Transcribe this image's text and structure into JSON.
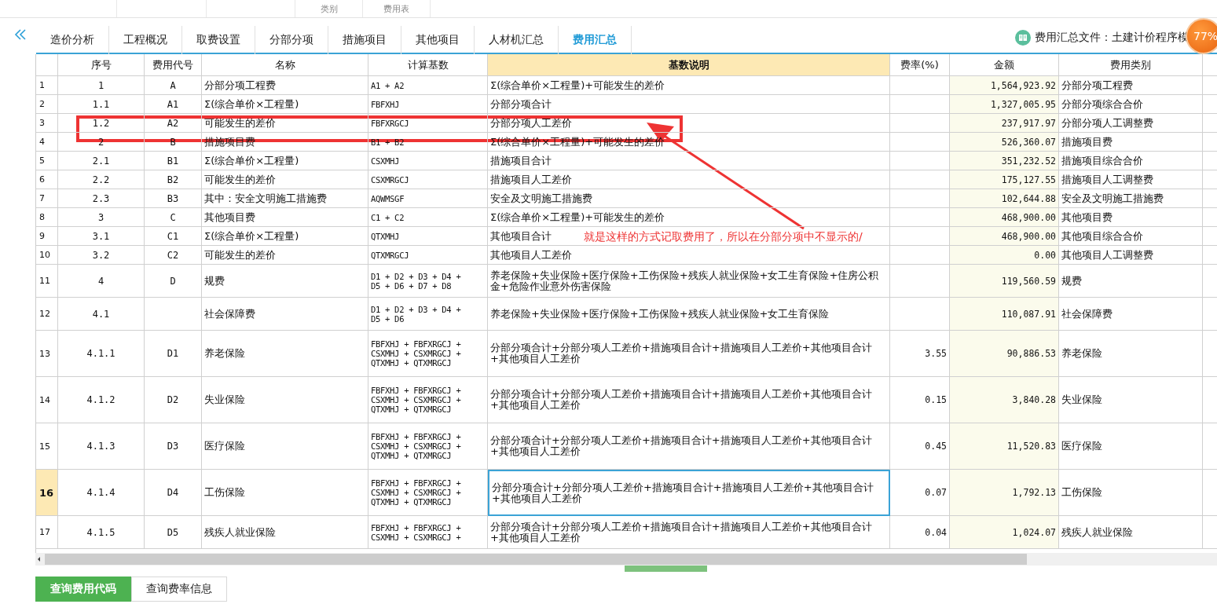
{
  "top_strip": [
    "类别",
    "费用表"
  ],
  "tabs": [
    {
      "label": "造价分析",
      "selected": false
    },
    {
      "label": "工程概况",
      "selected": false
    },
    {
      "label": "取费设置",
      "selected": false
    },
    {
      "label": "分部分项",
      "selected": false
    },
    {
      "label": "措施项目",
      "selected": false
    },
    {
      "label": "其他项目",
      "selected": false
    },
    {
      "label": "人材机汇总",
      "selected": false
    },
    {
      "label": "费用汇总",
      "selected": true
    }
  ],
  "file_label": "费用汇总文件：土建计价程序模",
  "progress_badge": "77%",
  "table": {
    "columns": [
      "序号",
      "费用代号",
      "名称",
      "计算基数",
      "基数说明",
      "费率(%)",
      "金额",
      "费用类别"
    ],
    "rows": [
      {
        "index": "1",
        "no": "1",
        "code": "A",
        "name": "分部分项工程费",
        "calc": [
          "A1 + A2"
        ],
        "desc": "Σ(综合单价×工程量)+可能发生的差价",
        "rate": "",
        "amount": "1,564,923.92",
        "category": "分部分项工程费",
        "selected": false
      },
      {
        "index": "2",
        "no": "1.1",
        "code": "A1",
        "name": "Σ(综合单价×工程量)",
        "calc": [
          "FBFXHJ"
        ],
        "desc": "分部分项合计",
        "rate": "",
        "amount": "1,327,005.95",
        "category": "分部分项综合合价",
        "selected": false
      },
      {
        "index": "3",
        "no": "1.2",
        "code": "A2",
        "name": "可能发生的差价",
        "calc": [
          "FBFXRGCJ"
        ],
        "desc": "分部分项人工差价",
        "rate": "",
        "amount": "237,917.97",
        "category": "分部分项人工调整费",
        "selected": false
      },
      {
        "index": "4",
        "no": "2",
        "code": "B",
        "name": "措施项目费",
        "calc": [
          "B1 + B2"
        ],
        "desc": "Σ(综合单价×工程量)+可能发生的差价",
        "rate": "",
        "amount": "526,360.07",
        "category": "措施项目费",
        "selected": false
      },
      {
        "index": "5",
        "no": "2.1",
        "code": "B1",
        "name": "Σ(综合单价×工程量)",
        "calc": [
          "CSXMHJ"
        ],
        "desc": "措施项目合计",
        "rate": "",
        "amount": "351,232.52",
        "category": "措施项目综合合价",
        "selected": false
      },
      {
        "index": "6",
        "no": "2.2",
        "code": "B2",
        "name": "可能发生的差价",
        "calc": [
          "CSXMRGCJ"
        ],
        "desc": "措施项目人工差价",
        "rate": "",
        "amount": "175,127.55",
        "category": "措施项目人工调整费",
        "selected": false
      },
      {
        "index": "7",
        "no": "2.3",
        "code": "B3",
        "name": "其中：安全文明施工措施费",
        "calc": [
          "AQWMSGF"
        ],
        "desc": "安全及文明施工措施费",
        "rate": "",
        "amount": "102,644.88",
        "category": "安全及文明施工措施费",
        "selected": false
      },
      {
        "index": "8",
        "no": "3",
        "code": "C",
        "name": "其他项目费",
        "calc": [
          "C1 + C2"
        ],
        "desc": "Σ(综合单价×工程量)+可能发生的差价",
        "rate": "",
        "amount": "468,900.00",
        "category": "其他项目费",
        "selected": false
      },
      {
        "index": "9",
        "no": "3.1",
        "code": "C1",
        "name": "Σ(综合单价×工程量)",
        "calc": [
          "QTXMHJ"
        ],
        "desc": "其他项目合计",
        "rate": "",
        "amount": "468,900.00",
        "category": "其他项目综合合价",
        "selected": false
      },
      {
        "index": "10",
        "no": "3.2",
        "code": "C2",
        "name": "可能发生的差价",
        "calc": [
          "QTXMRGCJ"
        ],
        "desc": "其他项目人工差价",
        "rate": "",
        "amount": "0.00",
        "category": "其他项目人工调整费",
        "selected": false
      },
      {
        "index": "11",
        "no": "4",
        "code": "D",
        "name": "规费",
        "calc": [
          "D1 + D2 + D3 + D4 +",
          "D5 + D6 + D7 + D8"
        ],
        "desc": "养老保险+失业保险+医疗保险+工伤保险+残疾人就业保险+女工生育保险+住房公积金+危险作业意外伤害保险",
        "rate": "",
        "amount": "119,560.59",
        "category": "规费",
        "selected": false
      },
      {
        "index": "12",
        "no": "4.1",
        "code": "",
        "name": "社会保障费",
        "calc": [
          "D1 + D2 + D3 + D4 +",
          "D5 + D6"
        ],
        "desc": "养老保险+失业保险+医疗保险+工伤保险+残疾人就业保险+女工生育保险",
        "rate": "",
        "amount": "110,087.91",
        "category": "社会保障费",
        "selected": false
      },
      {
        "index": "13",
        "no": "4.1.1",
        "code": "D1",
        "name": "养老保险",
        "calc": [
          "FBFXHJ + FBFXRGCJ +",
          "CSXMHJ + CSXMRGCJ +",
          "QTXMHJ + QTXMRGCJ"
        ],
        "desc": "分部分项合计+分部分项人工差价+措施项目合计+措施项目人工差价+其他项目合计+其他项目人工差价",
        "rate": "3.55",
        "amount": "90,886.53",
        "category": "养老保险",
        "selected": false
      },
      {
        "index": "14",
        "no": "4.1.2",
        "code": "D2",
        "name": "失业保险",
        "calc": [
          "FBFXHJ + FBFXRGCJ +",
          "CSXMHJ + CSXMRGCJ +",
          "QTXMHJ + QTXMRGCJ"
        ],
        "desc": "分部分项合计+分部分项人工差价+措施项目合计+措施项目人工差价+其他项目合计+其他项目人工差价",
        "rate": "0.15",
        "amount": "3,840.28",
        "category": "失业保险",
        "selected": false
      },
      {
        "index": "15",
        "no": "4.1.3",
        "code": "D3",
        "name": "医疗保险",
        "calc": [
          "FBFXHJ + FBFXRGCJ +",
          "CSXMHJ + CSXMRGCJ +",
          "QTXMHJ + QTXMRGCJ"
        ],
        "desc": "分部分项合计+分部分项人工差价+措施项目合计+措施项目人工差价+其他项目合计+其他项目人工差价",
        "rate": "0.45",
        "amount": "11,520.83",
        "category": "医疗保险",
        "selected": false
      },
      {
        "index": "16",
        "no": "4.1.4",
        "code": "D4",
        "name": "工伤保险",
        "calc": [
          "FBFXHJ + FBFXRGCJ +",
          "CSXMHJ + CSXMRGCJ +",
          "QTXMHJ + QTXMRGCJ"
        ],
        "desc": "分部分项合计+分部分项人工差价+措施项目合计+措施项目人工差价+其他项目合计+其他项目人工差价",
        "rate": "0.07",
        "amount": "1,792.13",
        "category": "工伤保险",
        "selected": true
      },
      {
        "index": "17",
        "no": "4.1.5",
        "code": "D5",
        "name": "残疾人就业保险",
        "calc": [
          "FBFXHJ + FBFXRGCJ +",
          "CSXMHJ + CSXMRGCJ +"
        ],
        "desc": "分部分项合计+分部分项人工差价+措施项目合计+措施项目人工差价+其他项目合计+其他项目人工差价",
        "rate": "0.04",
        "amount": "1,024.07",
        "category": "残疾人就业保险",
        "selected": false
      }
    ]
  },
  "annotation": {
    "text": "就是这样的方式记取费用了，所以在分部分项中不显示的/"
  },
  "bottom_tabs": [
    {
      "label": "查询费用代码",
      "selected": true
    },
    {
      "label": "查询费率信息",
      "selected": false
    }
  ]
}
